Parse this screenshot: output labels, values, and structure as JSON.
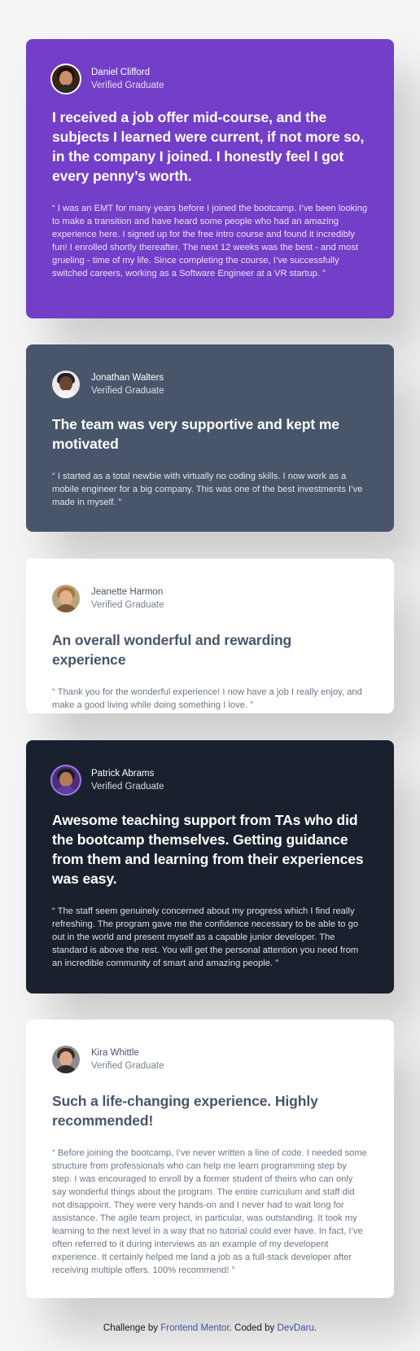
{
  "testimonials": [
    {
      "name": "Daniel Clifford",
      "role": "Verified Graduate",
      "headline": "I received a job offer mid-course, and the subjects I learned were current, if not more so, in the company I joined. I honestly feel I got every penny’s worth.",
      "quote": "“ I was an EMT for many years before I joined the bootcamp. I’ve been looking to make a transition and have heard some people who had an amazing experience here. I signed up for the free intro course and found it incredibly fun! I enrolled shortly thereafter. The next 12 weeks was the best - and most grueling - time of my life. Since completing the course, I’ve successfully switched careers, working as a Software Engineer at a VR startup. ”",
      "card_color": "#733fc8"
    },
    {
      "name": "Jonathan Walters",
      "role": "Verified Graduate",
      "headline": "The team was very supportive and kept me motivated",
      "quote": "“ I started as a total newbie with virtually no coding skills. I now work as a mobile engineer for a big company. This was one of the best investments I’ve made in myself. ”",
      "card_color": "#48556a"
    },
    {
      "name": "Jeanette Harmon",
      "role": "Verified Graduate",
      "headline": "An overall wonderful and rewarding experience",
      "quote": "“ Thank you for the wonderful experience! I now have a job I really enjoy, and make a good living while doing something I love. ”",
      "card_color": "#ffffff"
    },
    {
      "name": "Patrick Abrams",
      "role": "Verified Graduate",
      "headline": "Awesome teaching support from TAs who did the bootcamp themselves. Getting guidance from them and learning from their experiences was easy.",
      "quote": "“ The staff seem genuinely concerned about my progress which I find really refreshing. The program gave me the confidence necessary to be able to go out in the world and present myself as a capable junior developer. The standard is above the rest. You will get the personal attention you need from an incredible community of smart and amazing people. ”",
      "card_color": "#19212e"
    },
    {
      "name": "Kira Whittle",
      "role": "Verified Graduate",
      "headline": "Such a life-changing experience. Highly recommended!",
      "quote": "“ Before joining the bootcamp, I’ve never written a line of code. I needed some structure from professionals who can help me learn programming step by step. I was encouraged to enroll by a former student of theirs who can only say wonderful things about the program. The entire curriculum and staff did not disappoint. They were very hands-on and I never had to wait long for assistance. The agile team project, in particular, was outstanding. It took my learning to the next level in a way that no tutorial could ever have. In fact, I’ve often referred to it during interviews as an example of my developent experience. It certainly helped me land a job as a full-stack developer after receiving multiple offers. 100% recommend! ”",
      "card_color": "#ffffff"
    }
  ],
  "footer": {
    "prefix": "Challenge by",
    "frontend_mentor": "Frontend Mentor",
    "middle": ". Coded by",
    "author": "DevDaru",
    "suffix": "."
  },
  "colors": {
    "purple": "#733fc8",
    "slate": "#48556a",
    "white": "#ffffff",
    "dark": "#19212e",
    "background": "#f4f4f5",
    "link": "#3e52a3"
  }
}
